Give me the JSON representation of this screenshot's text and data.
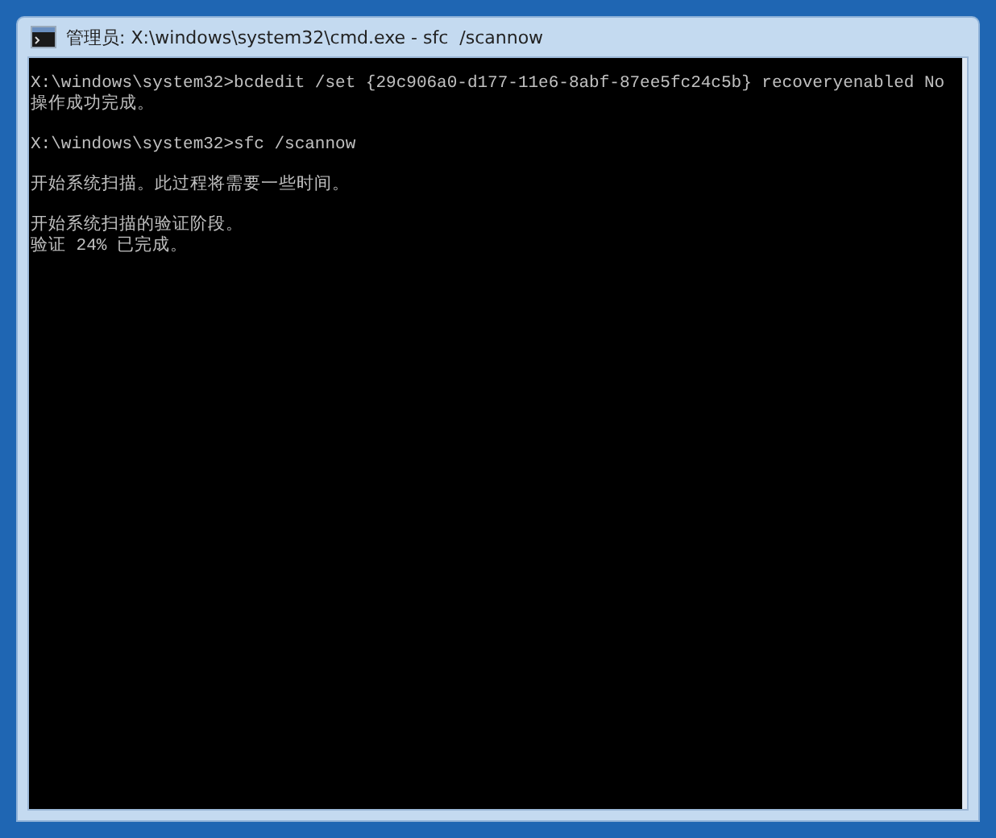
{
  "window": {
    "title": "管理员: X:\\windows\\system32\\cmd.exe - sfc  /scannow"
  },
  "console": {
    "blocks": [
      [
        "X:\\windows\\system32>bcdedit /set {29c906a0-d177-11e6-8abf-87ee5fc24c5b} recoveryenabled No",
        "操作成功完成。"
      ],
      [
        "X:\\windows\\system32>sfc /scannow"
      ],
      [
        "开始系统扫描。此过程将需要一些时间。"
      ],
      [
        "开始系统扫描的验证阶段。",
        "验证 24% 已完成。"
      ]
    ]
  }
}
